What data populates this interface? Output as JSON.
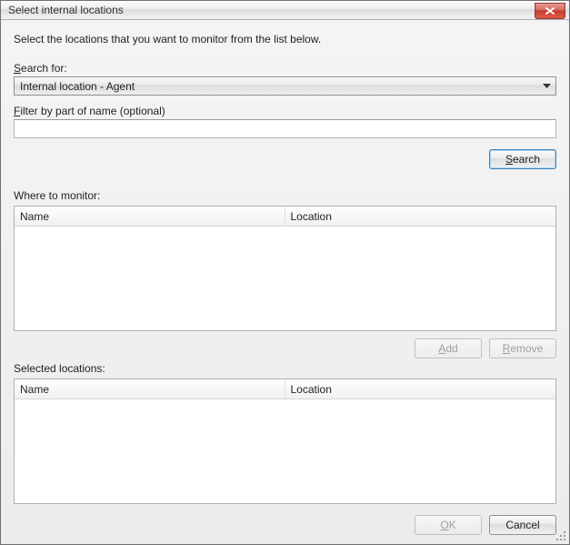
{
  "window": {
    "title": "Select internal locations"
  },
  "instruction": "Select the locations that you want to monitor from the list below.",
  "search": {
    "label_prefix": "S",
    "label_rest": "earch for:",
    "selected": "Internal location - Agent",
    "filter_label_prefix": "F",
    "filter_label_rest": "ilter by part of name (optional)",
    "filter_value": "",
    "button_prefix": "S",
    "button_rest": "earch"
  },
  "monitor": {
    "label": "Where to monitor:",
    "columns": {
      "name": "Name",
      "location": "Location"
    }
  },
  "buttons": {
    "add_prefix": "A",
    "add_rest": "dd",
    "remove_prefix": "R",
    "remove_rest": "emove",
    "ok_prefix": "O",
    "ok_rest": "K",
    "cancel": "Cancel"
  },
  "selected": {
    "label": "Selected locations:",
    "columns": {
      "name": "Name",
      "location": "Location"
    }
  }
}
